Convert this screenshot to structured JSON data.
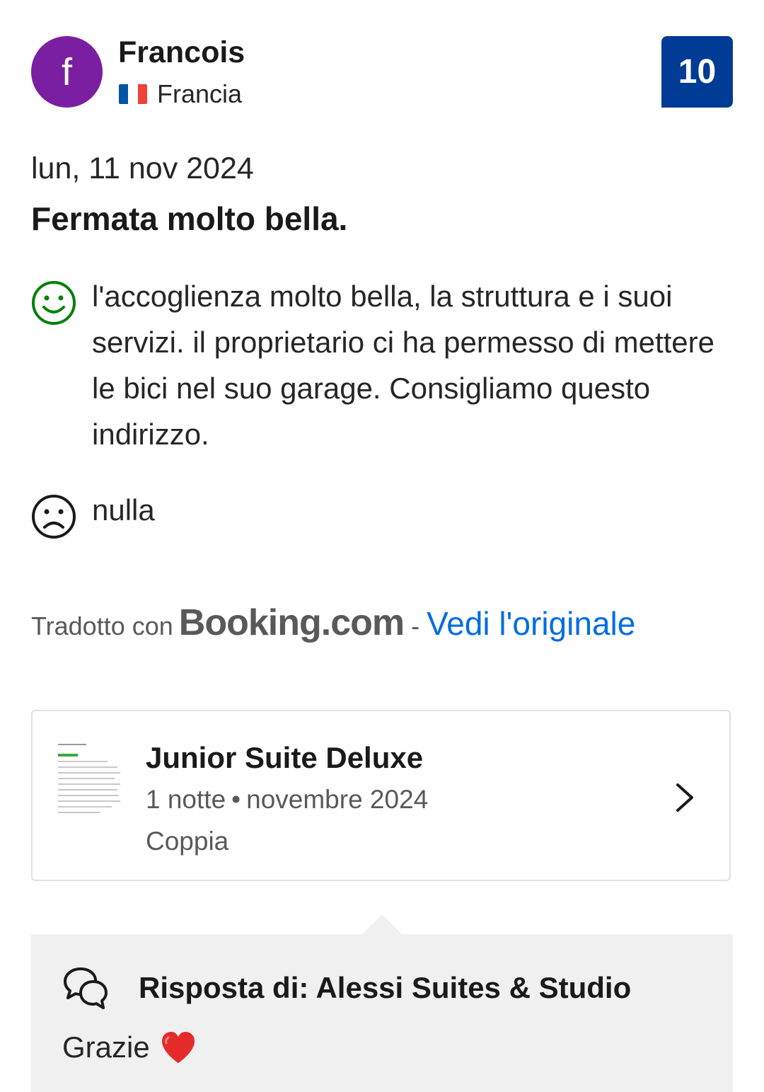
{
  "reviewer": {
    "initial": "f",
    "name": "Francois",
    "country": "Francia",
    "avatar_color": "#7b1fa2",
    "flag_colors": [
      "#0055a4",
      "#ffffff",
      "#ef4135"
    ]
  },
  "score": {
    "value": "10",
    "color": "#003b95"
  },
  "review": {
    "date": "lun, 11 nov 2024",
    "title": "Fermata molto bella.",
    "positive_icon": "smiley-icon",
    "positive": "l'accoglienza molto bella, la struttura e i suoi servizi. il proprietario ci ha permesso di mettere le bici nel suo garage. Consigliamo questo indirizzo.",
    "negative_icon": "sad-face-icon",
    "negative": "nulla"
  },
  "translation": {
    "label": "Tradotto con",
    "brand": "Booking.com",
    "separator": "-",
    "link": "Vedi l'originale",
    "link_color": "#006ce4"
  },
  "stay": {
    "room": "Junior Suite Deluxe",
    "nights": "1 notte",
    "separator": "•",
    "month": "novembre 2024",
    "traveler_type": "Coppia",
    "chevron_icon": "chevron-right-icon"
  },
  "reply": {
    "icon": "chat-bubbles-icon",
    "title": "Risposta di: Alessi Suites & Studio",
    "text": "Grazie",
    "emoji": "red-heart-icon"
  }
}
